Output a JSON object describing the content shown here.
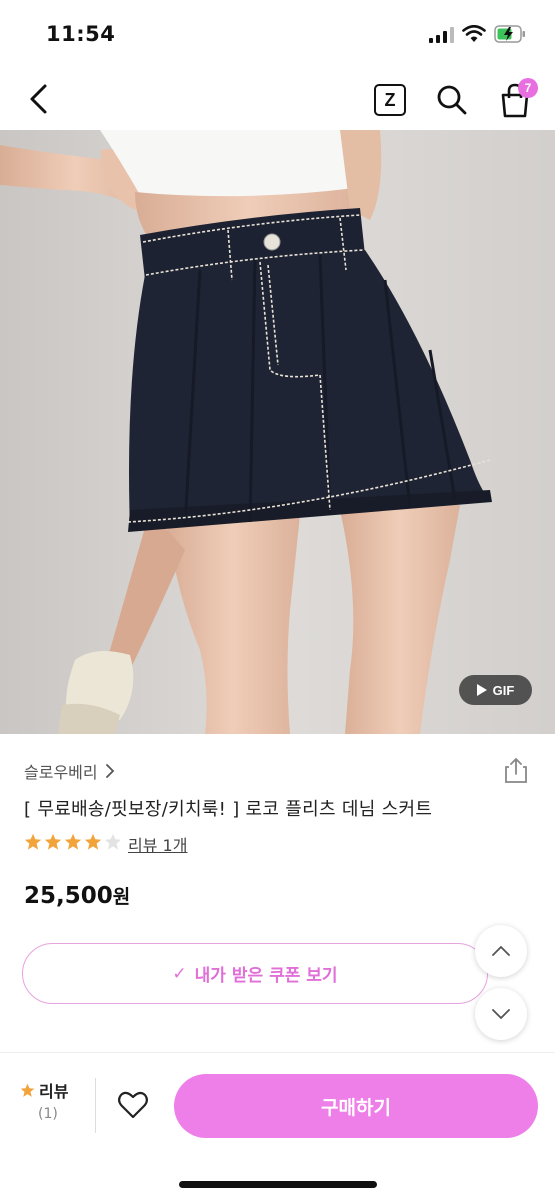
{
  "status_bar": {
    "time": "11:54"
  },
  "header": {
    "z_label": "Z",
    "cart_count": "7"
  },
  "image": {
    "gif_label": "GIF"
  },
  "product": {
    "brand": "슬로우베리",
    "title": "[ 무료배송/핏보장/키치룩! ] 로코 플리츠 데님 스커트",
    "rating": 4,
    "rating_max": 5,
    "review_link": "리뷰 1개",
    "price_number": "25,500",
    "price_unit": "원"
  },
  "coupon": {
    "label": "내가 받은 쿠폰 보기",
    "check": "✓"
  },
  "bottom_bar": {
    "review_label": "리뷰",
    "review_count": "(1)",
    "buy_label": "구매하기"
  },
  "colors": {
    "accent": "#ee7fe9",
    "coupon_text": "#e06fd8",
    "star": "#f2a33a"
  }
}
